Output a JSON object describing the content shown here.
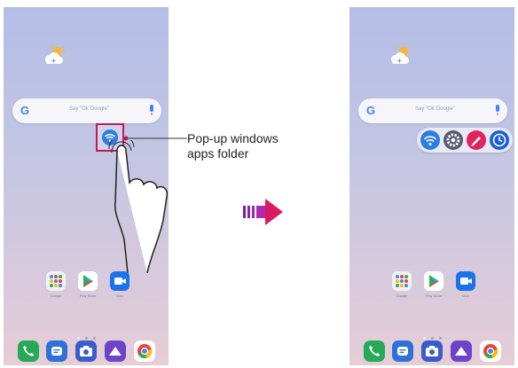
{
  "search": {
    "logo": "G",
    "hint": "Say \"Ok Google\""
  },
  "apps": {
    "row": [
      {
        "label": "Google",
        "icon": "google-folder-icon"
      },
      {
        "label": "Play Store",
        "icon": "play-store-icon"
      },
      {
        "label": "Duo",
        "icon": "duo-icon"
      }
    ]
  },
  "dock": [
    "phone-icon",
    "messages-icon",
    "camera-icon",
    "gallery-icon",
    "chrome-icon"
  ],
  "page_indicator": {
    "pages": 3,
    "current": 1
  },
  "callout": {
    "line1": "Pop-up windows",
    "line2": "apps folder"
  },
  "popup_apps": [
    "wifi-icon",
    "settings-icon",
    "edit-icon",
    "clock-icon"
  ],
  "colors": {
    "accent_folder": "#c2185b",
    "wifi_blue": "#2f7de1",
    "arrow_purple": "#7b1fa2"
  }
}
